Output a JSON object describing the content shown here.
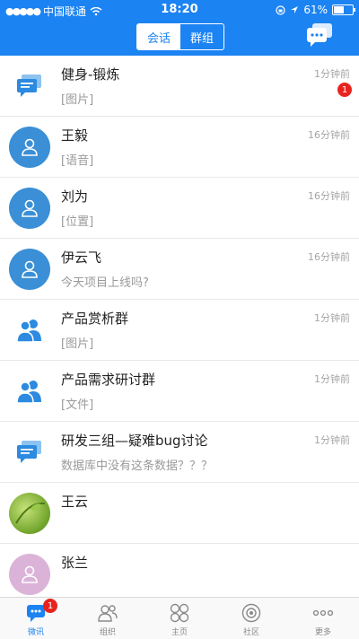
{
  "status_bar": {
    "carrier": "中国联通",
    "time": "18:20",
    "battery": "61%",
    "battery_level": 0.61
  },
  "header": {
    "tabs": [
      {
        "label": "会话",
        "active": true
      },
      {
        "label": "群组",
        "active": false
      }
    ],
    "right_icon": "chat-bubbles-icon"
  },
  "conversations": [
    {
      "name": "健身-锻炼",
      "preview": "[图片]",
      "time": "1分钟前",
      "unread": "1",
      "avatar": "group-chat-icon"
    },
    {
      "name": "王毅",
      "preview": "[语音]",
      "time": "16分钟前",
      "avatar": "person-icon"
    },
    {
      "name": "刘为",
      "preview": "[位置]",
      "time": "16分钟前",
      "avatar": "person-icon"
    },
    {
      "name": "伊云飞",
      "preview": "今天项目上线吗?",
      "time": "16分钟前",
      "avatar": "person-icon"
    },
    {
      "name": "产品赏析群",
      "preview": "[图片]",
      "time": "1分钟前",
      "avatar": "people-icon"
    },
    {
      "name": "产品需求研讨群",
      "preview": "[文件]",
      "time": "1分钟前",
      "avatar": "people-icon"
    },
    {
      "name": "研发三组—疑难bug讨论",
      "preview": "数据库中没有这条数据？？？",
      "time": "1分钟前",
      "avatar": "group-chat-icon"
    },
    {
      "name": "王云",
      "preview": "",
      "time": "",
      "avatar": "photo-avatar"
    },
    {
      "name": "张兰",
      "preview": "",
      "time": "",
      "avatar": "person-icon"
    }
  ],
  "tab_bar": [
    {
      "label": "微讯",
      "active": true,
      "badge": "1",
      "icon": "chat-icon"
    },
    {
      "label": "组织",
      "active": false,
      "icon": "contacts-icon"
    },
    {
      "label": "主页",
      "active": false,
      "icon": "home-grid-icon"
    },
    {
      "label": "社区",
      "active": false,
      "icon": "community-icon"
    },
    {
      "label": "更多",
      "active": false,
      "icon": "more-icon"
    }
  ],
  "colors": {
    "brand": "#1c83f2",
    "badge": "#e8231f",
    "avatar_blue": "#3a8fd6"
  }
}
